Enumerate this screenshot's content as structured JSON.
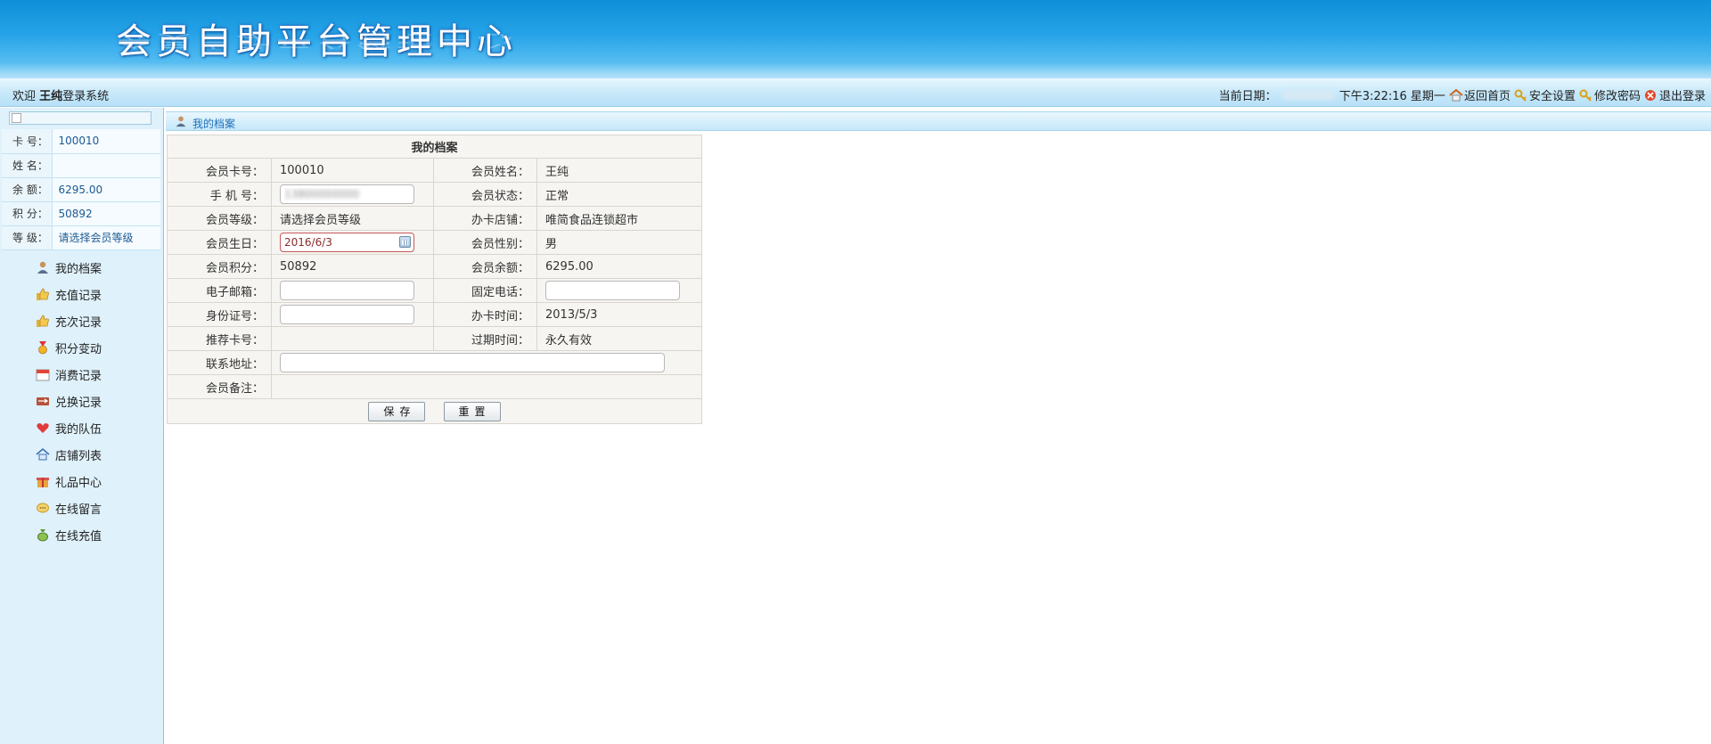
{
  "banner": {
    "title": "会员自助平台管理中心"
  },
  "topbar": {
    "welcome_prefix": "欢迎",
    "user_name": "王纯",
    "welcome_suffix": "登录系统",
    "date_label": "当前日期：",
    "time": "下午3:22:16 星期一",
    "links": {
      "home": "返回首页",
      "security": "安全设置",
      "password": "修改密码",
      "logout": "退出登录"
    }
  },
  "sidebar": {
    "info": [
      {
        "label": "卡  号：",
        "value": "100010"
      },
      {
        "label": "姓  名：",
        "value": ""
      },
      {
        "label": "余  额：",
        "value": "6295.00"
      },
      {
        "label": "积  分：",
        "value": "50892"
      },
      {
        "label": "等  级：",
        "value": "请选择会员等级"
      }
    ],
    "menu": [
      {
        "label": "我的档案",
        "icon": "user-icon"
      },
      {
        "label": "充值记录",
        "icon": "thumbs-up-icon"
      },
      {
        "label": "充次记录",
        "icon": "thumbs-up-icon"
      },
      {
        "label": "积分变动",
        "icon": "medal-icon"
      },
      {
        "label": "消费记录",
        "icon": "calendar-icon"
      },
      {
        "label": "兑换记录",
        "icon": "exchange-icon"
      },
      {
        "label": "我的队伍",
        "icon": "heart-icon"
      },
      {
        "label": "店铺列表",
        "icon": "home-icon"
      },
      {
        "label": "礼品中心",
        "icon": "gift-icon"
      },
      {
        "label": "在线留言",
        "icon": "chat-icon"
      },
      {
        "label": "在线充值",
        "icon": "money-bag-icon"
      }
    ]
  },
  "main": {
    "header_title": "我的档案",
    "caption": "我的档案",
    "rows": [
      {
        "l1": "会员卡号：",
        "v1": "100010",
        "l2": "会员姓名：",
        "v2": "王纯"
      },
      {
        "l1": "手 机 号：",
        "v1": "13800000000",
        "l2": "会员状态：",
        "v2": "正常"
      },
      {
        "l1": "会员等级：",
        "v1": "请选择会员等级",
        "l2": "办卡店铺：",
        "v2": "唯简食品连锁超市"
      },
      {
        "l1": "会员生日：",
        "v1": "2016/6/3",
        "l2": "会员性别：",
        "v2": "男"
      },
      {
        "l1": "会员积分：",
        "v1": "50892",
        "l2": "会员余额：",
        "v2": "6295.00"
      },
      {
        "l1": "电子邮箱：",
        "v1": "",
        "l2": "固定电话：",
        "v2": ""
      },
      {
        "l1": "身份证号：",
        "v1": "",
        "l2": "办卡时间：",
        "v2": "2013/5/3"
      },
      {
        "l1": "推荐卡号：",
        "v1": "",
        "l2": "过期时间：",
        "v2": "永久有效"
      },
      {
        "l1": "联系地址：",
        "v1": ""
      },
      {
        "l1": "会员备注：",
        "v1": ""
      }
    ],
    "save_label": "保存",
    "reset_label": "重置"
  }
}
